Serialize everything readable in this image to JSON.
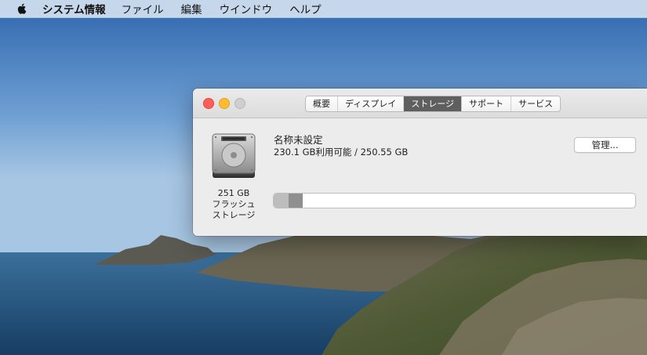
{
  "menubar": {
    "app_name": "システム情報",
    "items": [
      "ファイル",
      "編集",
      "ウインドウ",
      "ヘルプ"
    ]
  },
  "window": {
    "tabs": [
      "概要",
      "ディスプレイ",
      "ストレージ",
      "サポート",
      "サービス"
    ],
    "active_tab": "ストレージ"
  },
  "storage": {
    "disk_caption": [
      "251 GB",
      "フラッシュ",
      "ストレージ"
    ],
    "volume_name": "名称未設定",
    "availability": "230.1 GB利用可能 / 250.55 GB",
    "manage_label": "管理...",
    "used_fraction_light": 0.042,
    "used_fraction_dark": 0.04
  },
  "icons": {
    "apple": "apple-logo-icon",
    "disk": "flash-storage-drive-icon"
  }
}
